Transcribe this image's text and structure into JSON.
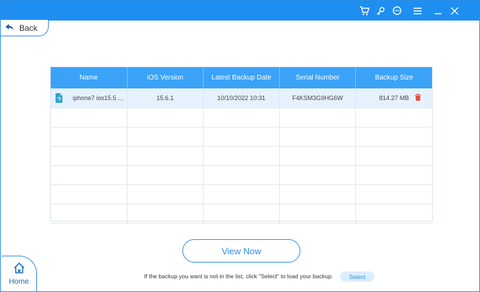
{
  "titlebar": {
    "icons": [
      "cart-icon",
      "key-icon",
      "chat-icon",
      "menu-icon",
      "minimize-icon",
      "close-icon"
    ]
  },
  "back": {
    "label": "Back"
  },
  "table": {
    "columns": [
      "Name",
      "iOS Version",
      "Latest Backup Date",
      "Serial Number",
      "Backup Size"
    ],
    "rows": [
      {
        "name": "iphone7 ios15.5 ...",
        "ios_version": "15.6.1",
        "backup_date": "10/10/2022 10:31",
        "serial": "F4KSM3G9HG6W",
        "size": "814.27 MB"
      }
    ]
  },
  "actions": {
    "view_now": "View Now",
    "hint": "If the backup you want is not in the list, click \"Select\" to load your backup.",
    "select": "Select"
  },
  "home": {
    "label": "Home"
  },
  "colors": {
    "accent": "#1f8ef1",
    "header": "#3ba3f7",
    "selected_row": "#e6f1fd",
    "delete": "#e34b3b"
  }
}
